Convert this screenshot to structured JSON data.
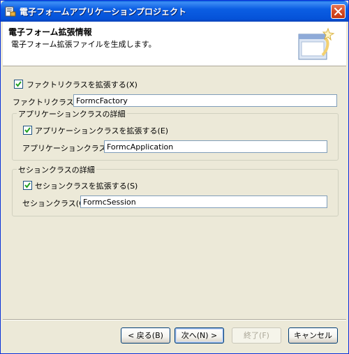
{
  "window": {
    "title": "電子フォームアプリケーションプロジェクト"
  },
  "banner": {
    "title": "電子フォーム拡張情報",
    "description": "電子フォーム拡張ファイルを生成します。"
  },
  "factory": {
    "checkbox_label": "ファクトリクラスを拡張する(X)",
    "checked": true,
    "field_label": "ファクトリクラス(T):",
    "field_value": "FormcFactory"
  },
  "application_group": {
    "legend": "アプリケーションクラスの詳細",
    "checkbox_label": "アプリケーションクラスを拡張する(E)",
    "checked": true,
    "field_label": "アプリケーションクラス(A):",
    "field_value": "FormcApplication"
  },
  "session_group": {
    "legend": "セションクラスの詳細",
    "checkbox_label": "セションクラスを拡張する(S)",
    "checked": true,
    "field_label": "セションクラス(C):",
    "field_value": "FormcSession"
  },
  "buttons": {
    "back": "< 戻る(B)",
    "next": "次へ(N) >",
    "finish": "終了(F)",
    "cancel": "キャンセル"
  },
  "icons": {
    "title": "app-icon",
    "close": "close-icon",
    "banner": "wizard-banner-icon"
  }
}
